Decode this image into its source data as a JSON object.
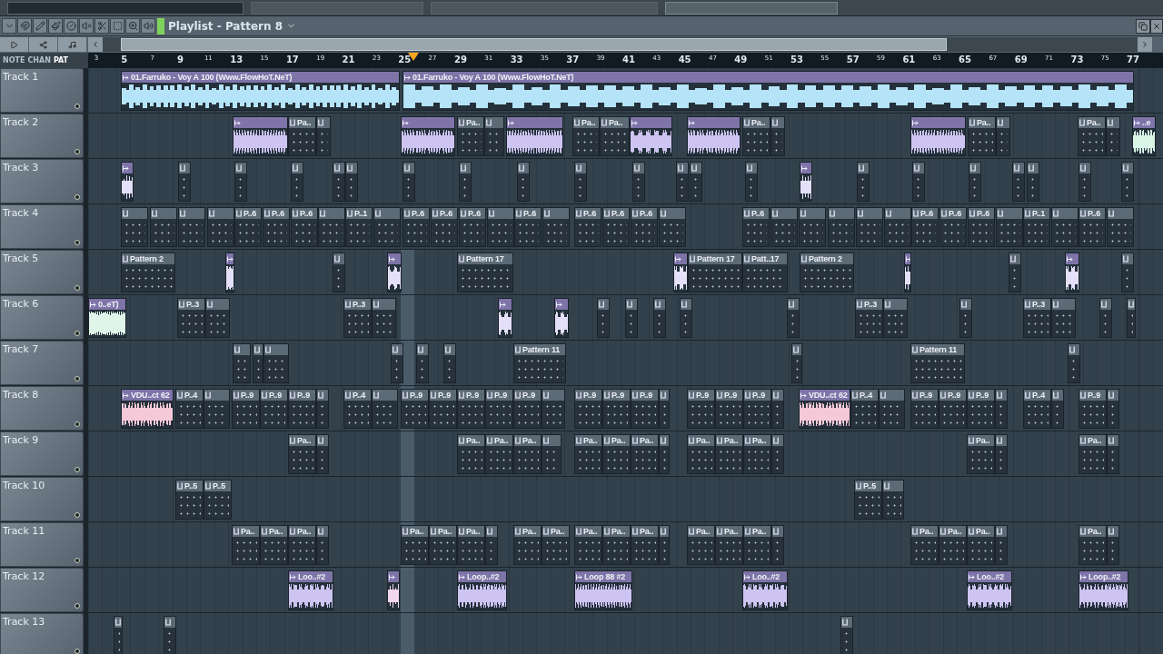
{
  "toolbar": {
    "title": "Playlist - Pattern 8"
  },
  "view_modes": [
    {
      "label": "NOTE",
      "selected": false
    },
    {
      "label": "CHAN",
      "selected": false
    },
    {
      "label": "PAT",
      "selected": true
    }
  ],
  "ruler": [
    "3",
    "5",
    "7",
    "9",
    "11",
    "13",
    "15",
    "17",
    "19",
    "21",
    "23",
    "25",
    "27",
    "29",
    "31",
    "33",
    "35",
    "37",
    "39",
    "41",
    "43",
    "45",
    "47",
    "49",
    "51",
    "53",
    "55",
    "57",
    "59",
    "61",
    "63",
    "65",
    "67",
    "69",
    "71",
    "73",
    "75",
    "77"
  ],
  "tracks": [
    {
      "name": "Track 1",
      "clips": [
        {
          "kind": "audio",
          "color": "#b5e3f7",
          "label": "01.Farruko - Voy A 100 (Www.FlowHoT.NeT)"
        },
        {
          "kind": "audio",
          "color": "#b5e3f7",
          "label": "01.Farruko - Voy A 100 (Www.FlowHoT.NeT)"
        }
      ]
    },
    {
      "name": "Track 2",
      "clips": [
        {
          "kind": "audio",
          "color": "#cdc4f2"
        },
        {
          "kind": "pattern",
          "label": "Pa.."
        },
        {
          "kind": "pattern"
        },
        {
          "kind": "audio",
          "color": "#cdc4f2"
        },
        {
          "kind": "pattern",
          "label": "Pa.."
        },
        {
          "kind": "pattern"
        },
        {
          "kind": "audio",
          "color": "#cdc4f2"
        },
        {
          "kind": "pattern",
          "label": "Pa.."
        },
        {
          "kind": "pattern",
          "label": "Pa.."
        },
        {
          "kind": "audio",
          "color": "#cdc4f2"
        },
        {
          "kind": "audio",
          "color": "#cdc4f2"
        },
        {
          "kind": "pattern",
          "label": "Pa.."
        },
        {
          "kind": "pattern"
        },
        {
          "kind": "audio",
          "color": "#cdc4f2"
        },
        {
          "kind": "pattern",
          "label": "Pa.."
        },
        {
          "kind": "pattern"
        },
        {
          "kind": "pattern",
          "label": "Pa.."
        },
        {
          "kind": "pattern"
        },
        {
          "kind": "audio",
          "color": "#d8f5e6",
          "label": "..e"
        }
      ]
    },
    {
      "name": "Track 3",
      "clips": [
        {
          "kind": "audio",
          "color": "#e4e0fa"
        },
        {
          "kind": "pattern"
        },
        {
          "kind": "pattern"
        },
        {
          "kind": "pattern"
        },
        {
          "kind": "pattern"
        },
        {
          "kind": "pattern"
        },
        {
          "kind": "pattern"
        },
        {
          "kind": "pattern"
        },
        {
          "kind": "pattern"
        },
        {
          "kind": "pattern"
        },
        {
          "kind": "pattern"
        },
        {
          "kind": "pattern"
        },
        {
          "kind": "pattern"
        },
        {
          "kind": "pattern"
        },
        {
          "kind": "audio",
          "color": "#e4e0fa"
        },
        {
          "kind": "pattern"
        },
        {
          "kind": "pattern"
        },
        {
          "kind": "pattern"
        },
        {
          "kind": "pattern"
        },
        {
          "kind": "pattern"
        },
        {
          "kind": "pattern"
        },
        {
          "kind": "pattern"
        }
      ]
    },
    {
      "name": "Track 4",
      "clips": [
        {
          "kind": "pattern"
        },
        {
          "kind": "pattern"
        },
        {
          "kind": "pattern"
        },
        {
          "kind": "pattern"
        },
        {
          "kind": "pattern",
          "label": "P..6"
        },
        {
          "kind": "pattern",
          "label": "P..6"
        },
        {
          "kind": "pattern",
          "label": "P..6"
        },
        {
          "kind": "pattern"
        },
        {
          "kind": "pattern",
          "label": "P..1"
        },
        {
          "kind": "pattern"
        },
        {
          "kind": "pattern",
          "label": "P..6"
        },
        {
          "kind": "pattern",
          "label": "P..6"
        },
        {
          "kind": "pattern",
          "label": "P..6"
        },
        {
          "kind": "pattern"
        },
        {
          "kind": "pattern",
          "label": "P..6"
        },
        {
          "kind": "pattern"
        },
        {
          "kind": "pattern",
          "label": "P..6"
        },
        {
          "kind": "pattern",
          "label": "P..6"
        },
        {
          "kind": "pattern",
          "label": "P..6"
        },
        {
          "kind": "pattern"
        },
        {
          "kind": "pattern",
          "label": "P..6"
        },
        {
          "kind": "pattern"
        },
        {
          "kind": "pattern"
        },
        {
          "kind": "pattern"
        },
        {
          "kind": "pattern"
        },
        {
          "kind": "pattern"
        },
        {
          "kind": "pattern",
          "label": "P..6"
        },
        {
          "kind": "pattern",
          "label": "P..6"
        },
        {
          "kind": "pattern",
          "label": "P..6"
        },
        {
          "kind": "pattern"
        },
        {
          "kind": "pattern",
          "label": "P..1"
        },
        {
          "kind": "pattern"
        },
        {
          "kind": "pattern",
          "label": "P..6"
        },
        {
          "kind": "pattern"
        }
      ]
    },
    {
      "name": "Track 5",
      "clips": [
        {
          "kind": "pattern",
          "label": "Pattern 2"
        },
        {
          "kind": "audio",
          "color": "#e4e0fa"
        },
        {
          "kind": "pattern"
        },
        {
          "kind": "audio",
          "color": "#e4e0fa"
        },
        {
          "kind": "pattern",
          "label": "Pattern 17"
        },
        {
          "kind": "audio",
          "color": "#e4e0fa"
        },
        {
          "kind": "pattern",
          "label": "Pattern 17"
        },
        {
          "kind": "pattern",
          "label": "Patt..17"
        },
        {
          "kind": "pattern",
          "label": "Pattern 2"
        },
        {
          "kind": "audio",
          "color": "#e4e0fa"
        },
        {
          "kind": "pattern"
        },
        {
          "kind": "audio",
          "color": "#e4e0fa"
        },
        {
          "kind": "pattern"
        }
      ]
    },
    {
      "name": "Track 6",
      "clips": [
        {
          "kind": "audio",
          "color": "#dff5ea",
          "label": "0..eT)"
        },
        {
          "kind": "pattern",
          "label": "P..3"
        },
        {
          "kind": "pattern"
        },
        {
          "kind": "pattern",
          "label": "P..3"
        },
        {
          "kind": "pattern"
        },
        {
          "kind": "audio",
          "color": "#e4e0fa"
        },
        {
          "kind": "audio",
          "color": "#e4e0fa"
        },
        {
          "kind": "pattern"
        },
        {
          "kind": "pattern"
        },
        {
          "kind": "pattern"
        },
        {
          "kind": "pattern"
        },
        {
          "kind": "pattern"
        },
        {
          "kind": "pattern",
          "label": "P..3"
        },
        {
          "kind": "pattern"
        },
        {
          "kind": "pattern"
        },
        {
          "kind": "pattern",
          "label": "P..3"
        },
        {
          "kind": "pattern"
        },
        {
          "kind": "pattern"
        },
        {
          "kind": "pattern"
        }
      ]
    },
    {
      "name": "Track 7",
      "clips": [
        {
          "kind": "pattern"
        },
        {
          "kind": "pattern"
        },
        {
          "kind": "pattern"
        },
        {
          "kind": "pattern"
        },
        {
          "kind": "pattern"
        },
        {
          "kind": "pattern"
        },
        {
          "kind": "pattern",
          "label": "Pattern 11"
        },
        {
          "kind": "pattern"
        },
        {
          "kind": "pattern",
          "label": "Pattern 11"
        },
        {
          "kind": "pattern"
        }
      ]
    },
    {
      "name": "Track 8",
      "clips": [
        {
          "kind": "audio",
          "color": "#f6c9d8",
          "label": "VDU..ct 62"
        },
        {
          "kind": "pattern",
          "label": "P..4"
        },
        {
          "kind": "pattern"
        },
        {
          "kind": "pattern",
          "label": "P..9"
        },
        {
          "kind": "pattern",
          "label": "P..9"
        },
        {
          "kind": "pattern",
          "label": "P..9"
        },
        {
          "kind": "pattern"
        },
        {
          "kind": "pattern",
          "label": "P..4"
        },
        {
          "kind": "pattern"
        },
        {
          "kind": "pattern",
          "label": "P..9"
        },
        {
          "kind": "pattern",
          "label": "P..9"
        },
        {
          "kind": "pattern",
          "label": "P..9"
        },
        {
          "kind": "pattern",
          "label": "P..9"
        },
        {
          "kind": "pattern",
          "label": "P..9"
        },
        {
          "kind": "pattern"
        },
        {
          "kind": "pattern",
          "label": "P..9"
        },
        {
          "kind": "pattern",
          "label": "P..9"
        },
        {
          "kind": "pattern",
          "label": "P..9"
        },
        {
          "kind": "pattern"
        },
        {
          "kind": "pattern",
          "label": "P..9"
        },
        {
          "kind": "pattern",
          "label": "P..9"
        },
        {
          "kind": "pattern",
          "label": "P..9"
        },
        {
          "kind": "pattern"
        },
        {
          "kind": "audio",
          "color": "#f6c9d8",
          "label": "VDU..ct 62"
        },
        {
          "kind": "pattern",
          "label": "P..4"
        },
        {
          "kind": "pattern"
        },
        {
          "kind": "pattern",
          "label": "P..9"
        },
        {
          "kind": "pattern",
          "label": "P..9"
        },
        {
          "kind": "pattern",
          "label": "P..9"
        },
        {
          "kind": "pattern"
        },
        {
          "kind": "pattern",
          "label": "P..4"
        },
        {
          "kind": "pattern"
        },
        {
          "kind": "pattern",
          "label": "P..9"
        },
        {
          "kind": "pattern"
        }
      ]
    },
    {
      "name": "Track 9",
      "clips": [
        {
          "kind": "pattern",
          "label": "Pa.."
        },
        {
          "kind": "pattern"
        },
        {
          "kind": "pattern",
          "label": "Pa.."
        },
        {
          "kind": "pattern",
          "label": "Pa.."
        },
        {
          "kind": "pattern",
          "label": "Pa.."
        },
        {
          "kind": "pattern"
        },
        {
          "kind": "pattern",
          "label": "Pa.."
        },
        {
          "kind": "pattern",
          "label": "Pa.."
        },
        {
          "kind": "pattern",
          "label": "Pa.."
        },
        {
          "kind": "pattern"
        },
        {
          "kind": "pattern",
          "label": "Pa.."
        },
        {
          "kind": "pattern",
          "label": "Pa.."
        },
        {
          "kind": "pattern",
          "label": "Pa.."
        },
        {
          "kind": "pattern"
        },
        {
          "kind": "pattern",
          "label": "Pa.."
        },
        {
          "kind": "pattern"
        },
        {
          "kind": "pattern",
          "label": "Pa.."
        },
        {
          "kind": "pattern"
        }
      ]
    },
    {
      "name": "Track 10",
      "clips": [
        {
          "kind": "pattern",
          "label": "P..5"
        },
        {
          "kind": "pattern",
          "label": "P..5"
        },
        {
          "kind": "pattern",
          "label": "P..5"
        },
        {
          "kind": "pattern"
        }
      ]
    },
    {
      "name": "Track 11",
      "clips": [
        {
          "kind": "pattern",
          "label": "Pa.."
        },
        {
          "kind": "pattern",
          "label": "Pa.."
        },
        {
          "kind": "pattern",
          "label": "Pa.."
        },
        {
          "kind": "pattern"
        },
        {
          "kind": "pattern",
          "label": "Pa.."
        },
        {
          "kind": "pattern",
          "label": "Pa.."
        },
        {
          "kind": "pattern",
          "label": "Pa.."
        },
        {
          "kind": "pattern"
        },
        {
          "kind": "pattern",
          "label": "Pa.."
        },
        {
          "kind": "pattern",
          "label": "Pa.."
        },
        {
          "kind": "pattern",
          "label": "Pa.."
        },
        {
          "kind": "pattern",
          "label": "Pa.."
        },
        {
          "kind": "pattern",
          "label": "Pa.."
        },
        {
          "kind": "pattern"
        },
        {
          "kind": "pattern",
          "label": "Pa.."
        },
        {
          "kind": "pattern",
          "label": "Pa.."
        },
        {
          "kind": "pattern",
          "label": "Pa.."
        },
        {
          "kind": "pattern"
        },
        {
          "kind": "pattern",
          "label": "Pa.."
        },
        {
          "kind": "pattern",
          "label": "Pa.."
        },
        {
          "kind": "pattern",
          "label": "Pa.."
        },
        {
          "kind": "pattern"
        },
        {
          "kind": "pattern",
          "label": "Pa.."
        },
        {
          "kind": "pattern"
        }
      ]
    },
    {
      "name": "Track 12",
      "clips": [
        {
          "kind": "audio",
          "color": "#cdc4f2",
          "label": "Loo..#2"
        },
        {
          "kind": "audio",
          "color": "#f3d6f0"
        },
        {
          "kind": "audio",
          "color": "#cdc4f2",
          "label": "Loop..#2"
        },
        {
          "kind": "audio",
          "color": "#cdc4f2",
          "label": "Loop 88 #2"
        },
        {
          "kind": "audio",
          "color": "#cdc4f2",
          "label": "Loo..#2"
        },
        {
          "kind": "audio",
          "color": "#cdc4f2",
          "label": "Loo..#2"
        },
        {
          "kind": "audio",
          "color": "#cdc4f2",
          "label": "Loop..#2"
        }
      ]
    },
    {
      "name": "Track 13",
      "clips": [
        {
          "kind": "pattern"
        },
        {
          "kind": "pattern"
        },
        {
          "kind": "pattern"
        }
      ]
    }
  ]
}
